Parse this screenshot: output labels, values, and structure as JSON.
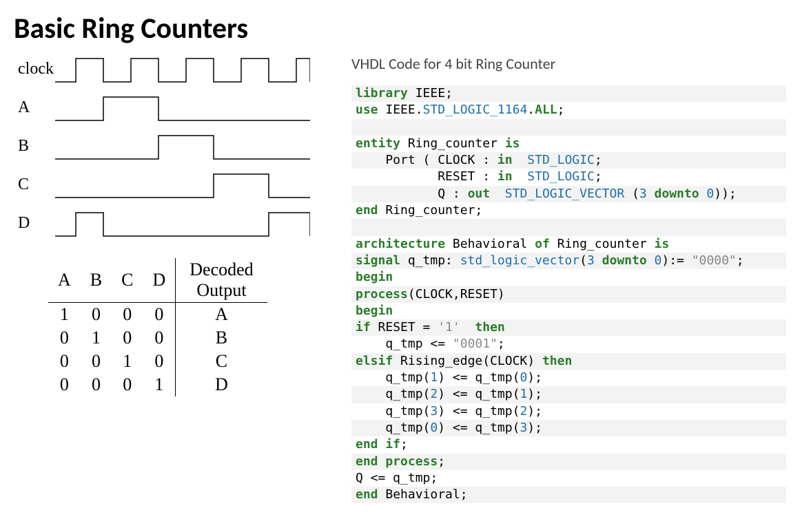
{
  "title": "Basic Ring Counters",
  "waveforms": {
    "labels": [
      "clock",
      "A",
      "B",
      "C",
      "D"
    ]
  },
  "truth_table": {
    "headers": [
      "A",
      "B",
      "C",
      "D"
    ],
    "decoded_header_top": "Decoded",
    "decoded_header_bottom": "Output",
    "rows": [
      {
        "bits": [
          "1",
          "0",
          "0",
          "0"
        ],
        "out": "A"
      },
      {
        "bits": [
          "0",
          "1",
          "0",
          "0"
        ],
        "out": "B"
      },
      {
        "bits": [
          "0",
          "0",
          "1",
          "0"
        ],
        "out": "C"
      },
      {
        "bits": [
          "0",
          "0",
          "0",
          "1"
        ],
        "out": "D"
      }
    ]
  },
  "code_title": "VHDL Code for 4 bit Ring Counter",
  "code": {
    "lines": [
      [
        {
          "t": "library ",
          "c": "kw"
        },
        {
          "t": "IEEE",
          "c": "id"
        },
        {
          "t": ";",
          "c": "punc"
        }
      ],
      [
        {
          "t": "use ",
          "c": "kw"
        },
        {
          "t": "IEEE",
          "c": "id"
        },
        {
          "t": ".",
          "c": "punc"
        },
        {
          "t": "STD_LOGIC_1164",
          "c": "type"
        },
        {
          "t": ".",
          "c": "punc"
        },
        {
          "t": "ALL",
          "c": "kw"
        },
        {
          "t": ";",
          "c": "punc"
        }
      ],
      [],
      [
        {
          "t": "entity ",
          "c": "kw"
        },
        {
          "t": "Ring_counter ",
          "c": "id"
        },
        {
          "t": "is",
          "c": "kw"
        }
      ],
      [
        {
          "t": "    Port ( CLOCK : ",
          "c": "id"
        },
        {
          "t": "in",
          "c": "kw"
        },
        {
          "t": "  ",
          "c": "id"
        },
        {
          "t": "STD_LOGIC",
          "c": "type"
        },
        {
          "t": ";",
          "c": "punc"
        }
      ],
      [
        {
          "t": "           RESET : ",
          "c": "id"
        },
        {
          "t": "in",
          "c": "kw"
        },
        {
          "t": "  ",
          "c": "id"
        },
        {
          "t": "STD_LOGIC",
          "c": "type"
        },
        {
          "t": ";",
          "c": "punc"
        }
      ],
      [
        {
          "t": "           Q : ",
          "c": "id"
        },
        {
          "t": "out",
          "c": "kw"
        },
        {
          "t": "  ",
          "c": "id"
        },
        {
          "t": "STD_LOGIC_VECTOR",
          "c": "type"
        },
        {
          "t": " (",
          "c": "punc"
        },
        {
          "t": "3",
          "c": "num"
        },
        {
          "t": " ",
          "c": "id"
        },
        {
          "t": "downto",
          "c": "kw"
        },
        {
          "t": " ",
          "c": "id"
        },
        {
          "t": "0",
          "c": "num"
        },
        {
          "t": "));",
          "c": "punc"
        }
      ],
      [
        {
          "t": "end ",
          "c": "kw"
        },
        {
          "t": "Ring_counter",
          "c": "id"
        },
        {
          "t": ";",
          "c": "punc"
        }
      ],
      [],
      [
        {
          "t": "architecture ",
          "c": "kw"
        },
        {
          "t": "Behavioral ",
          "c": "id"
        },
        {
          "t": "of ",
          "c": "kw"
        },
        {
          "t": "Ring_counter ",
          "c": "id"
        },
        {
          "t": "is",
          "c": "kw"
        }
      ],
      [
        {
          "t": "signal ",
          "c": "kw"
        },
        {
          "t": "q_tmp: ",
          "c": "id"
        },
        {
          "t": "std_logic_vector",
          "c": "type"
        },
        {
          "t": "(",
          "c": "punc"
        },
        {
          "t": "3",
          "c": "num"
        },
        {
          "t": " ",
          "c": "id"
        },
        {
          "t": "downto",
          "c": "kw"
        },
        {
          "t": " ",
          "c": "id"
        },
        {
          "t": "0",
          "c": "num"
        },
        {
          "t": "):= ",
          "c": "punc"
        },
        {
          "t": "\"0000\"",
          "c": "str"
        },
        {
          "t": ";",
          "c": "punc"
        }
      ],
      [
        {
          "t": "begin",
          "c": "kw"
        }
      ],
      [
        {
          "t": "process",
          "c": "kw"
        },
        {
          "t": "(CLOCK,RESET)",
          "c": "id"
        }
      ],
      [
        {
          "t": "begin",
          "c": "kw"
        }
      ],
      [
        {
          "t": "if ",
          "c": "kw"
        },
        {
          "t": "RESET = ",
          "c": "id"
        },
        {
          "t": "'1'",
          "c": "str"
        },
        {
          "t": "  ",
          "c": "id"
        },
        {
          "t": "then",
          "c": "kw"
        }
      ],
      [
        {
          "t": "    q_tmp <= ",
          "c": "id"
        },
        {
          "t": "\"0001\"",
          "c": "str"
        },
        {
          "t": ";",
          "c": "punc"
        }
      ],
      [
        {
          "t": "elsif ",
          "c": "kw"
        },
        {
          "t": "Rising_edge(CLOCK) ",
          "c": "id"
        },
        {
          "t": "then",
          "c": "kw"
        }
      ],
      [
        {
          "t": "    q_tmp(",
          "c": "id"
        },
        {
          "t": "1",
          "c": "num"
        },
        {
          "t": ") <= q_tmp(",
          "c": "id"
        },
        {
          "t": "0",
          "c": "num"
        },
        {
          "t": ");",
          "c": "punc"
        }
      ],
      [
        {
          "t": "    q_tmp(",
          "c": "id"
        },
        {
          "t": "2",
          "c": "num"
        },
        {
          "t": ") <= q_tmp(",
          "c": "id"
        },
        {
          "t": "1",
          "c": "num"
        },
        {
          "t": ");",
          "c": "punc"
        }
      ],
      [
        {
          "t": "    q_tmp(",
          "c": "id"
        },
        {
          "t": "3",
          "c": "num"
        },
        {
          "t": ") <= q_tmp(",
          "c": "id"
        },
        {
          "t": "2",
          "c": "num"
        },
        {
          "t": ");",
          "c": "punc"
        }
      ],
      [
        {
          "t": "    q_tmp(",
          "c": "id"
        },
        {
          "t": "0",
          "c": "num"
        },
        {
          "t": ") <= q_tmp(",
          "c": "id"
        },
        {
          "t": "3",
          "c": "num"
        },
        {
          "t": ");",
          "c": "punc"
        }
      ],
      [
        {
          "t": "end if",
          "c": "kw"
        },
        {
          "t": ";",
          "c": "punc"
        }
      ],
      [
        {
          "t": "end process",
          "c": "kw"
        },
        {
          "t": ";",
          "c": "punc"
        }
      ],
      [
        {
          "t": "Q <= q_tmp;",
          "c": "id"
        }
      ],
      [
        {
          "t": "end ",
          "c": "kw"
        },
        {
          "t": "Behavioral",
          "c": "id"
        },
        {
          "t": ";",
          "c": "punc"
        }
      ]
    ]
  }
}
